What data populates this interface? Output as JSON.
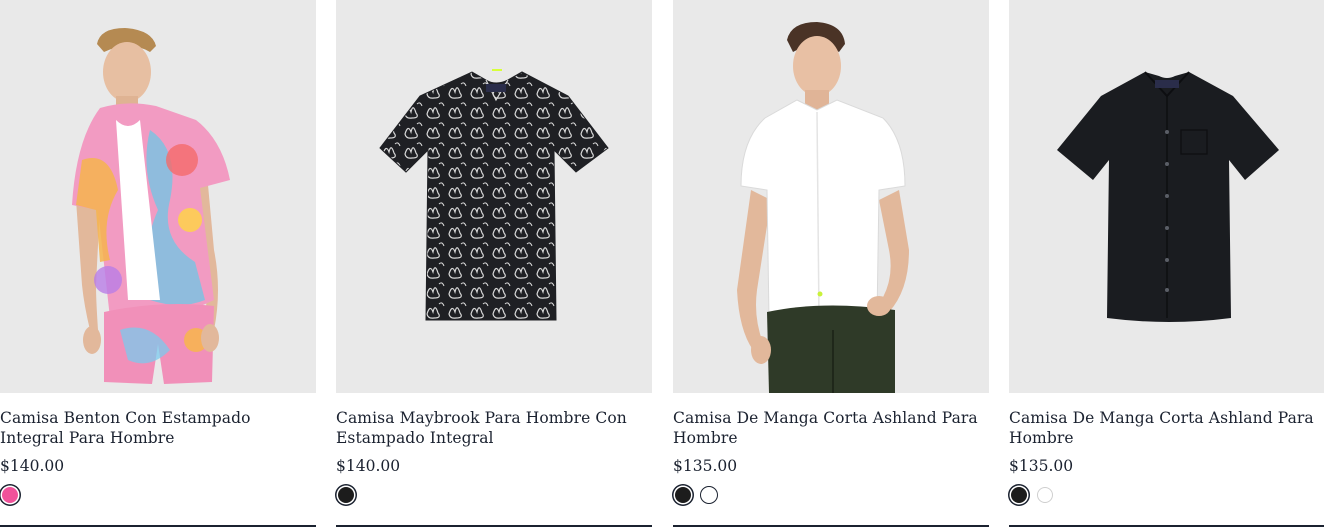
{
  "products": [
    {
      "title": "Camisa Benton Con Estampado Integral Para Hombre",
      "price": "$140.00",
      "swatches": [
        {
          "color": "#f0529a",
          "selected": true
        }
      ],
      "image": "model-wearing-pink-floral-print-shirt-and-shorts"
    },
    {
      "title": "Camisa Maybrook Para Hombre Con Estampado Integral",
      "price": "$140.00",
      "swatches": [
        {
          "color": "#1c1c1c",
          "selected": true
        }
      ],
      "image": "black-and-white-bunny-print-shirt"
    },
    {
      "title": "Camisa De Manga Corta Ashland Para Hombre",
      "price": "$135.00",
      "swatches": [
        {
          "color": "#1c1c1c",
          "selected": true
        },
        {
          "color": "#ffffff",
          "selected": false
        }
      ],
      "image": "model-wearing-white-short-sleeve-shirt"
    },
    {
      "title": "Camisa De Manga Corta Ashland Para Hombre",
      "price": "$135.00",
      "swatches": [
        {
          "color": "#1c1c1c",
          "selected": true
        },
        {
          "color": "#ffffff",
          "selected": false
        }
      ],
      "image": "black-short-sleeve-shirt"
    }
  ]
}
